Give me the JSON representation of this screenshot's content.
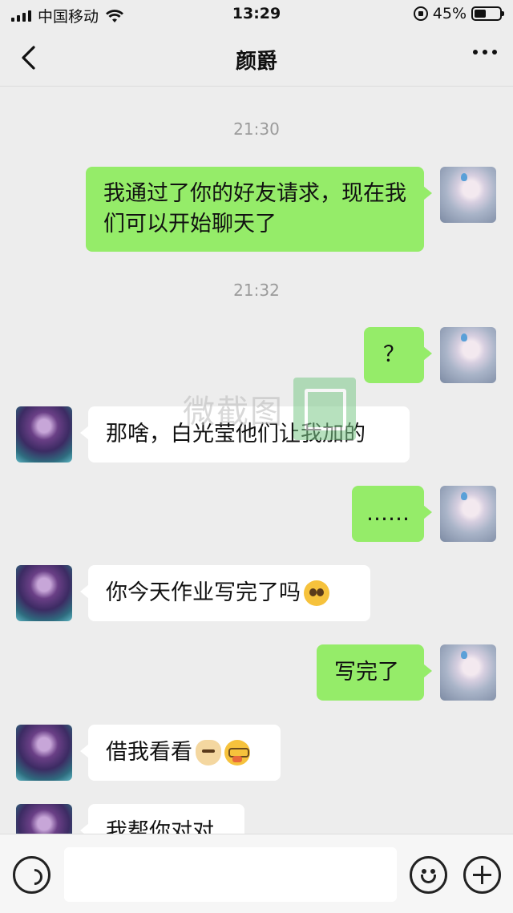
{
  "status_bar": {
    "carrier": "中国移动",
    "time": "13:29",
    "battery": "45%",
    "battery_level": 0.45
  },
  "header": {
    "title": "颜爵",
    "back_icon": "chevron-left-icon",
    "more_icon": "more-dots-icon"
  },
  "watermark": {
    "text": "微截图"
  },
  "messages": [
    {
      "type": "timestamp",
      "text": "21:30"
    },
    {
      "type": "me",
      "text": "我通过了你的好友请求，现在我们可以开始聊天了"
    },
    {
      "type": "timestamp",
      "text": "21:32"
    },
    {
      "type": "me",
      "text": "？"
    },
    {
      "type": "other",
      "text": "那啥，白光莹他们让我加的"
    },
    {
      "type": "me",
      "text": "……"
    },
    {
      "type": "other",
      "text": "你今天作业写完了吗",
      "emoji": [
        "pleading-face-emoji"
      ]
    },
    {
      "type": "me",
      "text": "写完了"
    },
    {
      "type": "other",
      "text": "借我看看",
      "emoji": [
        "doge-emoji",
        "nerd-face-emoji"
      ]
    },
    {
      "type": "other",
      "text": "我帮你对对"
    }
  ],
  "input_bar": {
    "voice_icon": "voice-icon",
    "emoji_icon": "emoji-icon",
    "plus_icon": "plus-icon",
    "placeholder": ""
  },
  "colors": {
    "background": "#ededed",
    "bubble_me": "#95ec69",
    "bubble_other": "#ffffff",
    "timestamp": "#9b9b9b"
  }
}
